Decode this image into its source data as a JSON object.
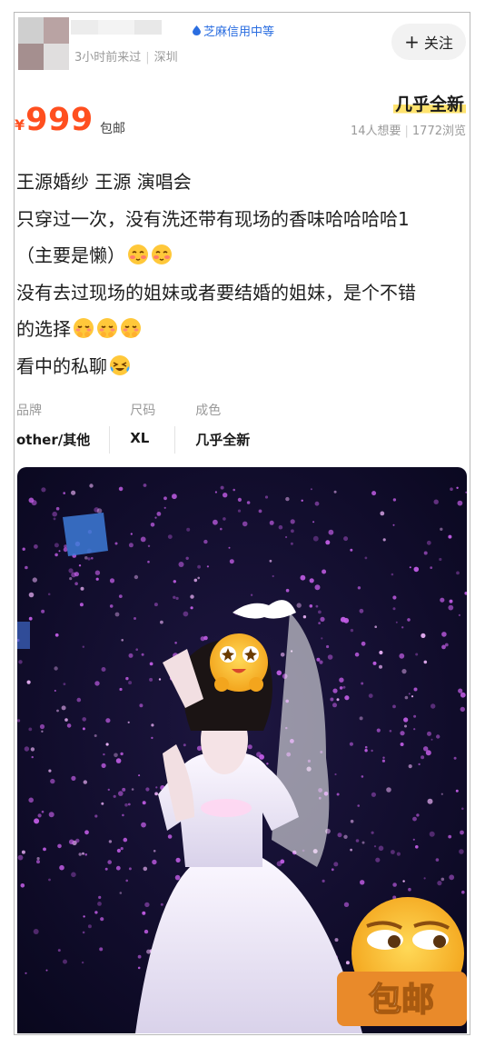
{
  "seller": {
    "name_blur": "",
    "credit_badge": "芝麻信用中等",
    "last_active": "3小时前来过",
    "location": "深圳",
    "follow_label": "关注",
    "follow_icon": "plus-icon"
  },
  "listing": {
    "price_currency": "¥",
    "price": "999",
    "shipping": "包邮",
    "condition": "几乎全新",
    "wants": "14人想要",
    "views": "1772浏览"
  },
  "description": {
    "lines": [
      "王源婚纱  王源 演唱会",
      "只穿过一次，没有洗还带有现场的香味哈哈哈哈1",
      "（主要是懒）",
      "没有去过现场的姐妹或者要结婚的姐妹，是个不错",
      "的选择",
      "看中的私聊"
    ],
    "emojis": [
      "blushing-face-icon",
      "blushing-face-icon",
      "shy-face-icon",
      "shy-face-icon",
      "shy-face-icon",
      "laughing-tears-face-icon"
    ]
  },
  "attributes": [
    {
      "key": "品牌",
      "value": "other/其他"
    },
    {
      "key": "尺码",
      "value": "XL"
    },
    {
      "key": "成色",
      "value": "几乎全新"
    }
  ],
  "photo": {
    "description_icons": [
      "star-eyes-emoji-sticker",
      "side-eye-emoji-sticker"
    ],
    "sticker_text": "包邮"
  },
  "colors": {
    "price": "#ff4f1f",
    "credit_blue": "#2a6de0",
    "highlight_yellow": "#ffe36e",
    "stage_purple": "#c45ee8"
  }
}
